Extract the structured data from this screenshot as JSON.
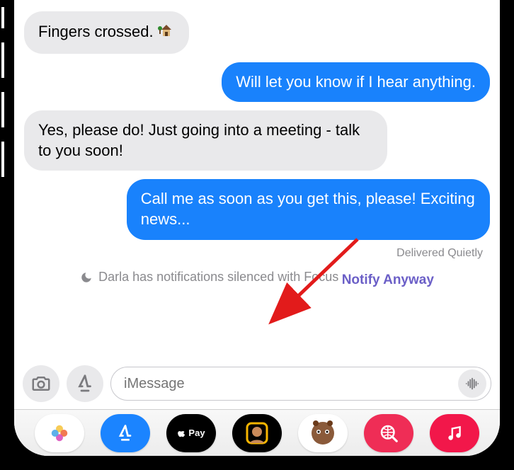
{
  "messages": {
    "m1": {
      "from": "in",
      "text": "Fingers crossed. "
    },
    "m2": {
      "from": "out",
      "text": "Will let you know if I hear anything."
    },
    "m3": {
      "from": "in",
      "text": "Yes, please do! Just going into a meeting - talk to you soon!"
    },
    "m4": {
      "from": "out",
      "text": "Call me as soon as you get this, please! Exciting news..."
    }
  },
  "status": {
    "delivered": "Delivered Quietly",
    "focus_text": "Darla has notifications silenced with Focus",
    "notify_anyway": "Notify Anyway"
  },
  "input": {
    "placeholder": "iMessage"
  },
  "applepay_label": "Pay",
  "colors": {
    "sent_bubble": "#1982fc",
    "received_bubble": "#e9e9eb",
    "notify_link": "#6b5fc7"
  }
}
